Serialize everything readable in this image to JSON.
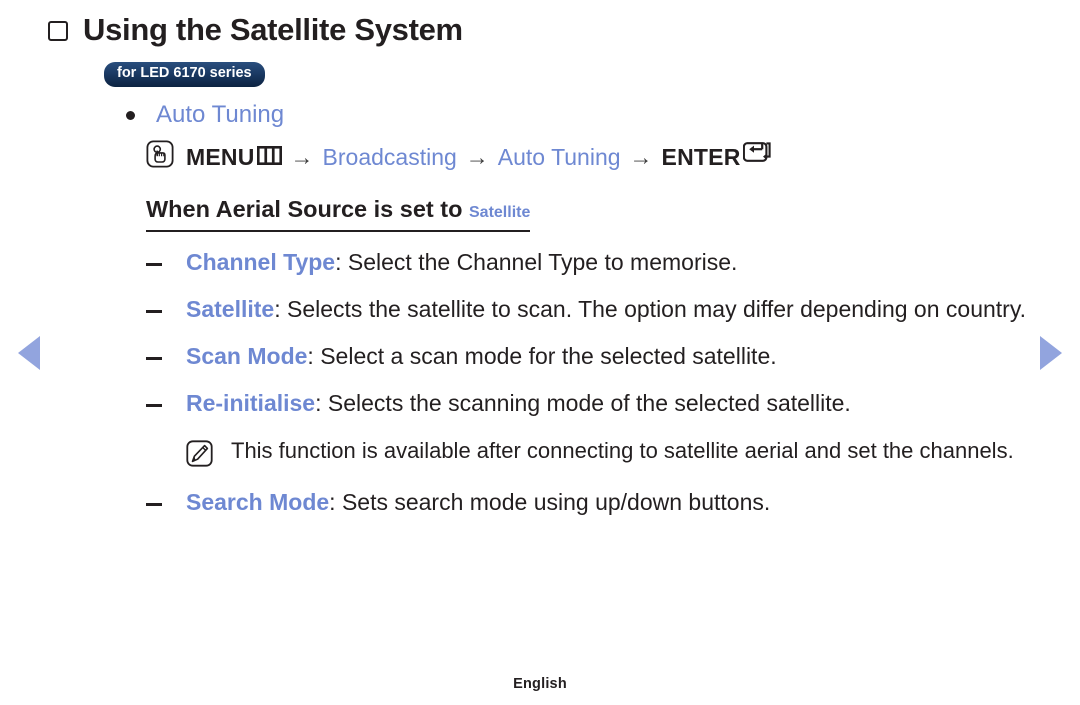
{
  "page": {
    "title": "Using the Satellite System",
    "badge": "for LED 6170 series",
    "footer": "English",
    "accent_color": "#6e88d2",
    "text_color": "#231f20",
    "badge_color": "#1b3a64",
    "arrow_color": "#92a4de"
  },
  "nav": {
    "prev_label": "◀",
    "next_label": "▶"
  },
  "section": {
    "bullet_label": "Auto Tuning",
    "path": {
      "menu": "MENU",
      "arrow": "→",
      "step1": "Broadcasting",
      "step2": "Auto Tuning",
      "enter": "ENTER"
    },
    "subheading": {
      "prefix": "When Aerial Source is set to ",
      "accent": "Satellite"
    }
  },
  "items": [
    {
      "term": "Channel Type",
      "separator": ": ",
      "description": "Select the Channel Type to memorise."
    },
    {
      "term": "Satellite",
      "separator": ": ",
      "description": "Selects the satellite to scan. The option may differ depending on country."
    },
    {
      "term": "Scan Mode",
      "separator": ": ",
      "description": "Select a scan mode for the selected satellite."
    },
    {
      "term": "Re-initialise",
      "separator": ": ",
      "description": "Selects the scanning mode of the selected satellite."
    }
  ],
  "note": {
    "text": "This function is available after connecting to satellite aerial and set the channels."
  },
  "items_after_note": [
    {
      "term": "Search Mode",
      "separator": ": ",
      "description": "Sets search mode using up/down buttons."
    }
  ],
  "icons": {
    "hand_press": "hand-press-icon",
    "menu_grid": "menu-grid-icon",
    "enter_key": "enter-key-icon",
    "note": "note-icon"
  }
}
